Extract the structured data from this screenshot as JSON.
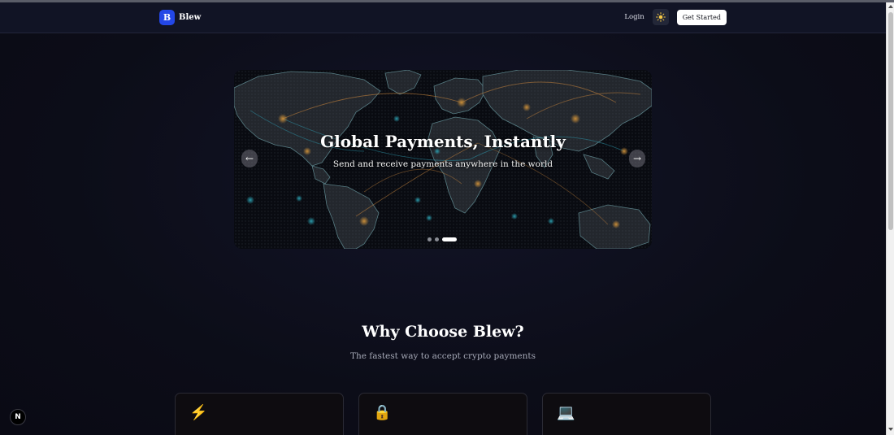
{
  "brand": {
    "logo_letter": "B",
    "name": "Blew",
    "accent": "#2347e6"
  },
  "nav": {
    "login_label": "Login",
    "theme_icon": "sun-icon",
    "cta_label": "Get Started"
  },
  "hero": {
    "title": "Global Payments, Instantly",
    "subtitle": "Send and receive payments anywhere in the world",
    "prev_glyph": "←",
    "next_glyph": "→",
    "slide_count": 3,
    "active_slide": 3
  },
  "why": {
    "title": "Why Choose Blew?",
    "subtitle": "The fastest way to accept crypto payments",
    "features": [
      {
        "icon": "lightning-icon",
        "glyph": "⚡"
      },
      {
        "icon": "lock-icon",
        "glyph": "🔒"
      },
      {
        "icon": "laptop-icon",
        "glyph": "💻"
      }
    ]
  },
  "devtools": {
    "badge_letter": "N"
  }
}
